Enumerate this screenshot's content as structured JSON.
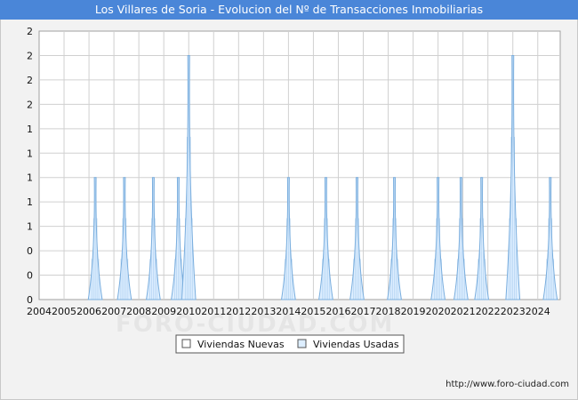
{
  "header": {
    "title": "Los Villares de Soria - Evolucion del Nº de Transacciones Inmobiliarias"
  },
  "footer": {
    "url": "http://www.foro-ciudad.com",
    "watermark": "FORO-CIUDAD.COM"
  },
  "colors": {
    "title_bar": "#4a86d8",
    "plot_background": "#ffffff",
    "grid": "#d0d0d0",
    "nuevas_fill": "#ffffff",
    "usadas_fill": "#ddeeff",
    "usadas_stroke": "#7aaede"
  },
  "chart_data": {
    "type": "area",
    "title": "Los Villares de Soria - Evolucion del Nº de Transacciones Inmobiliarias",
    "x_range": [
      2004,
      2024.9
    ],
    "x_tick_labels": [
      "2004",
      "2005",
      "2006",
      "2007",
      "2008",
      "2009",
      "2010",
      "2011",
      "2012",
      "2013",
      "2014",
      "2015",
      "2016",
      "2017",
      "2018",
      "2019",
      "2020",
      "2021",
      "2022",
      "2023",
      "2024"
    ],
    "y_range": [
      0,
      2.2
    ],
    "y_tick_labels": [
      "0",
      "0",
      "0",
      "1",
      "1",
      "1",
      "1",
      "1",
      "2",
      "2",
      "2",
      "2"
    ],
    "grid": true,
    "legend_position": "bottom-center",
    "series": [
      {
        "name": "Viviendas Nuevas",
        "values": []
      },
      {
        "name": "Viviendas Usadas",
        "values": [
          {
            "x": 2006.25,
            "y": 1
          },
          {
            "x": 2007.42,
            "y": 1
          },
          {
            "x": 2008.58,
            "y": 1
          },
          {
            "x": 2009.58,
            "y": 1
          },
          {
            "x": 2010.0,
            "y": 2
          },
          {
            "x": 2014.0,
            "y": 1
          },
          {
            "x": 2015.5,
            "y": 1
          },
          {
            "x": 2016.75,
            "y": 1
          },
          {
            "x": 2018.25,
            "y": 1
          },
          {
            "x": 2020.0,
            "y": 1
          },
          {
            "x": 2020.92,
            "y": 1
          },
          {
            "x": 2021.75,
            "y": 1
          },
          {
            "x": 2023.0,
            "y": 2
          },
          {
            "x": 2024.5,
            "y": 1
          }
        ]
      }
    ]
  }
}
